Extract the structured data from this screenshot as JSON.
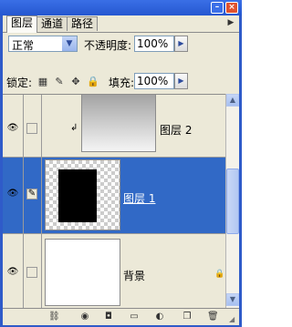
{
  "window": {
    "minimize_symbol": "–",
    "close_symbol": "×"
  },
  "tabs": [
    {
      "label": "图层",
      "active": true
    },
    {
      "label": "通道",
      "active": false
    },
    {
      "label": "路径",
      "active": false
    }
  ],
  "options": {
    "blend_mode": "正常",
    "opacity_label": "不透明度:",
    "opacity_value": "100%",
    "lock_label": "锁定:",
    "fill_label": "填充:",
    "fill_value": "100%"
  },
  "layers": [
    {
      "name": "图层 2",
      "visible": true,
      "selected": false,
      "clipped": true,
      "thumb": "gradient"
    },
    {
      "name": "图层 1",
      "visible": true,
      "selected": true,
      "clipped": false,
      "thumb": "black-rect-on-transparent"
    },
    {
      "name": "背景",
      "visible": true,
      "selected": false,
      "locked": true,
      "thumb": "white"
    }
  ],
  "icons": {
    "eye": "eye-icon",
    "brush": "brush-icon",
    "lock": "lock-icon",
    "clip_arrow": "clip-arrow-icon",
    "menu": "panel-menu-icon"
  },
  "colors": {
    "title_bar": "#2557d0",
    "selected_row": "#3169c6",
    "panel_bg": "#ece9d8"
  }
}
